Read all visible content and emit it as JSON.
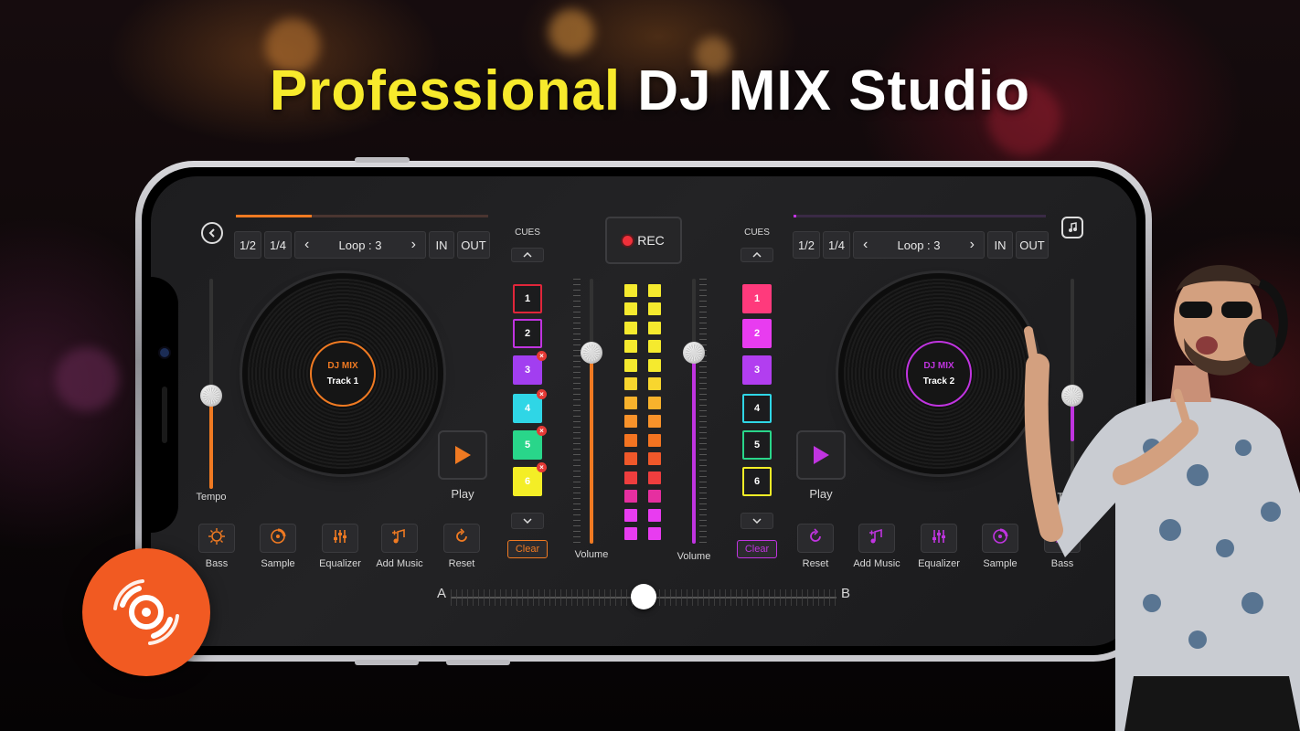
{
  "headline": {
    "part1": "Professional",
    "part2": "DJ MIX Studio"
  },
  "colors": {
    "accent_left": "#f07a22",
    "accent_right": "#c034e0",
    "title_yellow": "#f7ea2c",
    "logo_orange": "#f15a22"
  },
  "rec": {
    "label": "REC"
  },
  "deck_left": {
    "progress": 0.3,
    "buttons": {
      "half": "1/2",
      "quarter": "1/4",
      "loop": "Loop : 3",
      "in": "IN",
      "out": "OUT",
      "prev": "‹",
      "next": "›"
    },
    "disc_line1": "DJ MIX",
    "disc_line2": "Track 1",
    "tempo_label": "Tempo",
    "play_label": "Play",
    "tools": [
      {
        "label": "Bass",
        "icon": "bass-icon"
      },
      {
        "label": "Sample",
        "icon": "sample-icon"
      },
      {
        "label": "Equalizer",
        "icon": "equalizer-icon"
      },
      {
        "label": "Add Music",
        "icon": "add-music-icon"
      },
      {
        "label": "Reset",
        "icon": "reset-icon"
      }
    ]
  },
  "deck_right": {
    "progress": 0.01,
    "buttons": {
      "half": "1/2",
      "quarter": "1/4",
      "loop": "Loop : 3",
      "in": "IN",
      "out": "OUT",
      "prev": "‹",
      "next": "›"
    },
    "disc_line1": "DJ MIX",
    "disc_line2": "Track 2",
    "tempo_label": "Tempo",
    "play_label": "Play",
    "tools": [
      {
        "label": "Reset",
        "icon": "reset-icon"
      },
      {
        "label": "Add Music",
        "icon": "add-music-icon"
      },
      {
        "label": "Equalizer",
        "icon": "equalizer-icon"
      },
      {
        "label": "Sample",
        "icon": "sample-icon"
      },
      {
        "label": "Bass",
        "icon": "bass-icon"
      }
    ]
  },
  "cues_left": {
    "title": "CUES",
    "pads": [
      "1",
      "2",
      "3",
      "4",
      "5",
      "6"
    ],
    "clear": "Clear"
  },
  "cues_right": {
    "title": "CUES",
    "pads": [
      "1",
      "2",
      "3",
      "4",
      "5",
      "6"
    ],
    "clear": "Clear"
  },
  "mixer": {
    "volume_left": "Volume",
    "volume_right": "Volume",
    "level_left": 0.72,
    "level_right": 0.72
  },
  "crossfader": {
    "left": "A",
    "right": "B",
    "position": 0.5
  }
}
